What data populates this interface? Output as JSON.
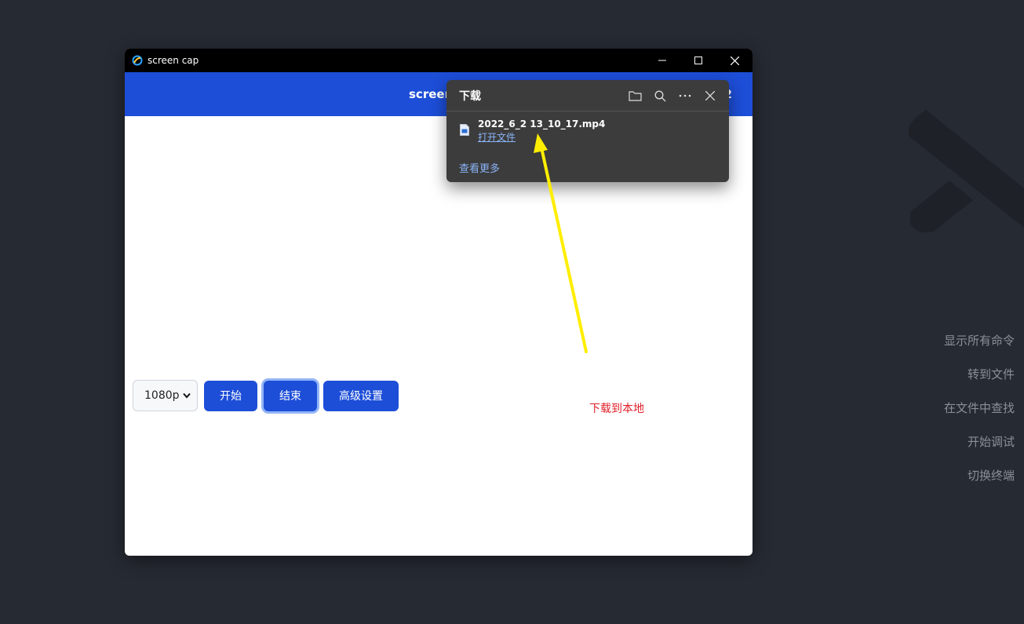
{
  "window": {
    "title": "screen cap"
  },
  "header": {
    "title_visible": "screenc",
    "tail_visible": "2"
  },
  "controls": {
    "resolution_selected": "1080p",
    "start_label": "开始",
    "stop_label": "结束",
    "advanced_label": "高级设置"
  },
  "downloads": {
    "title": "下载",
    "file_name": "2022_6_2 13_10_17.mp4",
    "open_file_label": "打开文件",
    "see_more_label": "查看更多"
  },
  "annotation": {
    "text": "下载到本地",
    "arrow_color": "#ffee00",
    "text_color": "#e0202a"
  },
  "background_commands": [
    "显示所有命令",
    "转到文件",
    "在文件中查找",
    "开始调试",
    "切换终端"
  ],
  "colors": {
    "accent": "#1d4ed8",
    "panel": "#3c3c3c",
    "link": "#8ab4f8"
  }
}
